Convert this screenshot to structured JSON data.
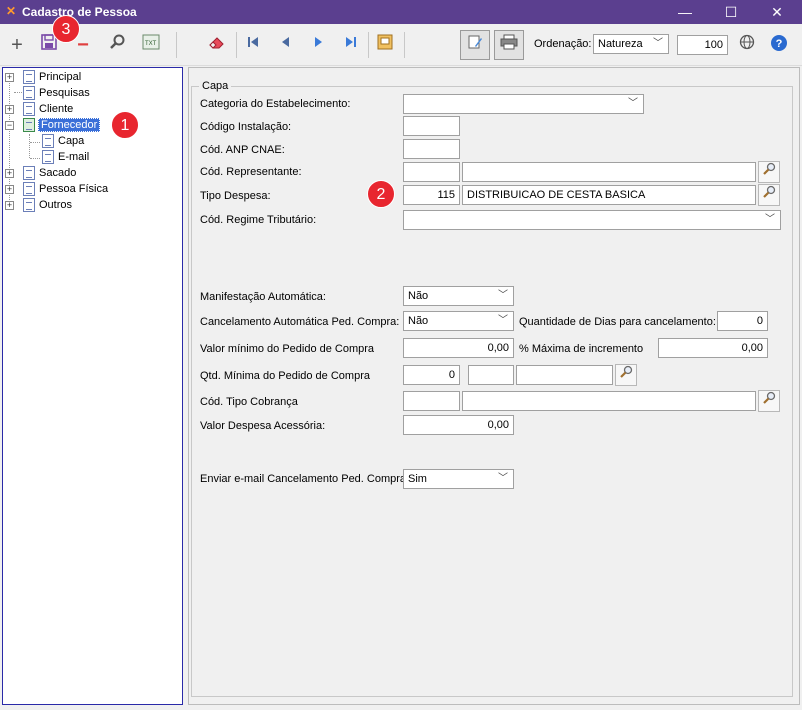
{
  "window": {
    "title": "Cadastro de Pessoa",
    "minimize": "—",
    "maximize": "☐",
    "close": "✕"
  },
  "toolbar": {
    "ordenacao_label": "Ordenação:",
    "ordenacao_value": "Natureza",
    "page_size": "100"
  },
  "tree": {
    "items": [
      {
        "label": "Principal"
      },
      {
        "label": "Pesquisas"
      },
      {
        "label": "Cliente"
      },
      {
        "label": "Fornecedor"
      },
      {
        "label": "Capa"
      },
      {
        "label": "E-mail"
      },
      {
        "label": "Sacado"
      },
      {
        "label": "Pessoa Física"
      },
      {
        "label": "Outros"
      }
    ]
  },
  "form": {
    "group_label": "Capa",
    "categoria_label": "Categoria do Estabelecimento:",
    "categoria_value": "",
    "codigo_instalacao_label": "Código Instalação:",
    "codigo_instalacao_value": "",
    "cod_anp_label": "Cód. ANP CNAE:",
    "cod_anp_value": "",
    "cod_representante_label": "Cód. Representante:",
    "cod_representante_code": "",
    "cod_representante_name": "",
    "tipo_despesa_label": "Tipo Despesa:",
    "tipo_despesa_code": "115",
    "tipo_despesa_name": "DISTRIBUICAO DE CESTA BASICA",
    "regime_label": "Cód. Regime Tributário:",
    "regime_value": "",
    "manifestacao_label": "Manifestação Automática:",
    "manifestacao_value": "Não",
    "cancelamento_label": "Cancelamento Automática Ped. Compra:",
    "cancelamento_value": "Não",
    "qtd_dias_label": "Quantidade de Dias para cancelamento:",
    "qtd_dias_value": "0",
    "valor_minimo_label": "Valor mínimo do Pedido de Compra",
    "valor_minimo_value": "0,00",
    "pct_maxima_label": "% Máxima de incremento",
    "pct_maxima_value": "0,00",
    "qtd_minima_label": "Qtd. Mínima do Pedido de Compra",
    "qtd_minima_value": "0",
    "qtd_minima_code": "",
    "qtd_minima_name": "",
    "tipo_cobranca_label": "Cód. Tipo Cobrança",
    "tipo_cobranca_code": "",
    "tipo_cobranca_name": "",
    "despesa_acessoria_label": "Valor Despesa Acessória:",
    "despesa_acessoria_value": "0,00",
    "enviar_email_label": "Enviar e-mail Cancelamento Ped. Compra:",
    "enviar_email_value": "Sim"
  },
  "badges": {
    "b1": "1",
    "b2": "2",
    "b3": "3"
  },
  "colors": {
    "titlebar": "#5b3f8f",
    "selection": "#3a6fd8",
    "badge": "#e8262f",
    "tree_border": "#2a2aa8"
  }
}
